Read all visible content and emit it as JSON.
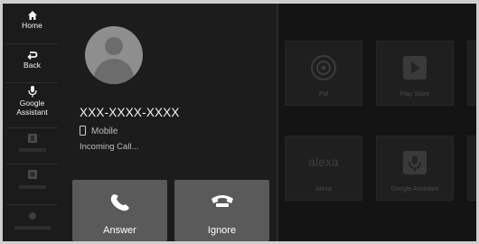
{
  "nav": {
    "items": [
      {
        "label": "Home",
        "icon": "home-icon"
      },
      {
        "label": "Back",
        "icon": "back-icon"
      },
      {
        "label": "Google Assistant",
        "icon": "microphone-icon"
      }
    ],
    "dimmed_icons": [
      "phone-icon",
      "screen-icon",
      "settings-icon"
    ]
  },
  "call": {
    "number": "XXX-XXXX-XXXX",
    "phone_type": "Mobile",
    "status": "Incoming Call...",
    "answer_label": "Answer",
    "ignore_label": "Ignore"
  },
  "apps": [
    {
      "label": "FM",
      "icon": "radio-icon"
    },
    {
      "label": "Play Store",
      "icon": "play-store-icon"
    },
    {
      "label": "Alexa",
      "logo_text": "alexa"
    },
    {
      "label": "Google Assistant",
      "icon": "microphone-icon"
    }
  ],
  "colors": {
    "background": "#141414",
    "panel": "#1c1c1c",
    "button": "#5a5a5a",
    "avatar": "#8e8e8e"
  }
}
